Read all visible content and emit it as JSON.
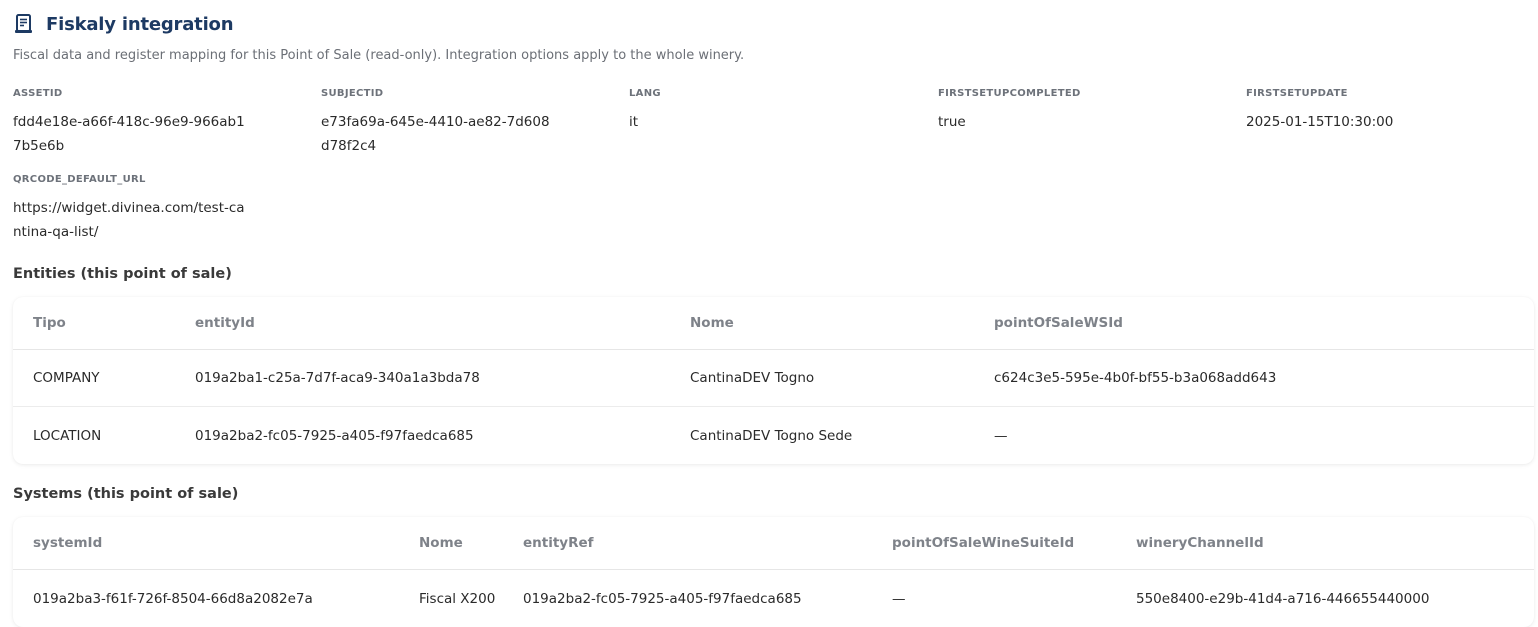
{
  "header": {
    "title": "Fiskaly integration",
    "icon": "receipt-icon",
    "subtitle": "Fiscal data and register mapping for this Point of Sale (read-only). Integration options apply to the whole winery."
  },
  "colors": {
    "title": "#1d3a63",
    "accent": "#1d3a63"
  },
  "fields": [
    {
      "label": "ASSETID",
      "value": "fdd4e18e-a66f-418c-96e9-966ab17b5e6b"
    },
    {
      "label": "SUBJECTID",
      "value": "e73fa69a-645e-4410-ae82-7d608d78f2c4"
    },
    {
      "label": "LANG",
      "value": "it"
    },
    {
      "label": "FIRSTSETUPCOMPLETED",
      "value": "true"
    },
    {
      "label": "FIRSTSETUPDATE",
      "value": "2025-01-15T10:30:00"
    },
    {
      "label": "QRCODE_DEFAULT_URL",
      "value": "https://widget.divinea.com/test-cantina-qa-list/"
    }
  ],
  "entities": {
    "title": "Entities (this point of sale)",
    "headers": [
      "Tipo",
      "entityId",
      "Nome",
      "pointOfSaleWSId"
    ],
    "rows": [
      [
        "COMPANY",
        "019a2ba1-c25a-7d7f-aca9-340a1a3bda78",
        "CantinaDEV Togno",
        "c624c3e5-595e-4b0f-bf55-b3a068add643"
      ],
      [
        "LOCATION",
        "019a2ba2-fc05-7925-a405-f97faedca685",
        "CantinaDEV Togno Sede",
        "—"
      ]
    ]
  },
  "systems": {
    "title": "Systems (this point of sale)",
    "headers": [
      "systemId",
      "Nome",
      "entityRef",
      "pointOfSaleWineSuiteId",
      "wineryChannelId"
    ],
    "rows": [
      [
        "019a2ba3-f61f-726f-8504-66d8a2082e7a",
        "Fiscal X200",
        "019a2ba2-fc05-7925-a405-f97faedca685",
        "—",
        "550e8400-e29b-41d4-a716-446655440000"
      ]
    ]
  }
}
